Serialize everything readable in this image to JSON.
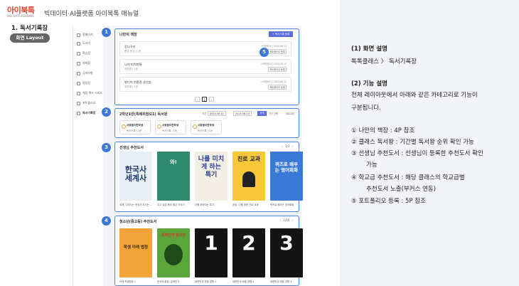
{
  "header": {
    "logo_main": "아이북톡",
    "logo_sub": "BIG DATA READING",
    "title": "빅데이터·AI플랫폼 아이북톡 매뉴얼"
  },
  "section": {
    "title": "1. 독서기록장",
    "pill": "화면 Layout"
  },
  "sidenav": {
    "items": [
      "홈페이지",
      "도서이",
      "학습장",
      "과제함",
      "공지사항",
      "알림장",
      "게임·퀴즈 스피드",
      "포트폴리오",
      "독서기록장"
    ]
  },
  "panel1": {
    "badge": "1",
    "title": "나만의 책장",
    "add_button": "+ 독서기록 등록",
    "rows": [
      {
        "title": "강나구리",
        "author": "한산 한국 | 1권",
        "meta": "시작한도서 | 2024.06.12",
        "button": "포트폴리오 등록"
      },
      {
        "title": "나의 피치피통",
        "author": "저자명 | 1권",
        "meta": "시작한도서 | 2024.06.12",
        "button": "포트폴리오 등록"
      },
      {
        "title": "발디어 친환경 생산법",
        "author": "교보재 | 1권",
        "meta": "시작한도서 | 2024.06.12",
        "button": "포트폴리오 등록"
      }
    ],
    "page": "1"
  },
  "badge5": "5",
  "panel2": {
    "badge": "2",
    "title": "2학년1반(특례위참오1) 독서왕",
    "period_label": "기간",
    "date_from": "2024-06-12",
    "date_to": "2024-06-23",
    "search": "검색",
    "opt1": "기간 선택",
    "opt2": "새로고침",
    "stats": [
      {
        "name": "사용율이란학생",
        "value": "독서기록 | 2권"
      },
      {
        "name": "사용율이란학생",
        "value": "독서기록 | 1권"
      },
      {
        "name": "사용율이란학생",
        "value": "독서기록 | 1권"
      }
    ]
  },
  "panel3": {
    "badge": "3",
    "title": "선생님 추천도서",
    "counter": "1/3",
    "books": [
      {
        "title": "한국사 세계사",
        "caption": "세계, 나라사는 한국사 도서는 ..."
      },
      {
        "title": "와!",
        "caption": "쉬고 싶은 몸의 좋은 이야기"
      },
      {
        "title": "나를 미치게 하는 특기",
        "caption": "나를 위하여는 특기"
      },
      {
        "title": "진로 교과",
        "caption": "공부, 나를 위한 진로 교과"
      },
      {
        "title": "퀴즈로 배우는 영어회화",
        "caption": "퀴즈로 배우는 영어회화"
      }
    ]
  },
  "panel4": {
    "badge": "4",
    "title": "청소년(중고등) 추천도서",
    "counter": "1/10",
    "books": [
      {
        "title": "학생 미래 법정",
        "caption": "미래 학생법정 1"
      },
      {
        "title": "존재인가 한국인",
        "caption": "한국의 환경, 존재인가"
      },
      {
        "title": "1",
        "caption": "대한민국 마음 영향 1"
      },
      {
        "title": "2",
        "caption": "대한민국 마음 영향 2"
      },
      {
        "title": "3",
        "caption": "대한민국 마음 영향 3"
      }
    ]
  },
  "description": {
    "h1": "(1) 화면 설명",
    "p1": "톡톡클래스 〉 독서기록장",
    "h2": "(2) 기능 설명",
    "p2a": "전체 레이아웃에서 아래와 같은 카테고리로 기능이",
    "p2b": "구분됩니다.",
    "list": [
      "①    나만의 책장 : 4P 참조",
      "②    클래스 독서왕 : 기간별 독서왕 순위 확인 가능",
      "③    선생님 추천도서 : 선생님이 등록한 추천도서 확인",
      "가능",
      "④    학교급 추천도서 : 해당 클래스의 학교급별",
      "추천도서 노출(부커스 연동)",
      "⑤    포트폴리오 등록 : 5P 참조"
    ]
  }
}
